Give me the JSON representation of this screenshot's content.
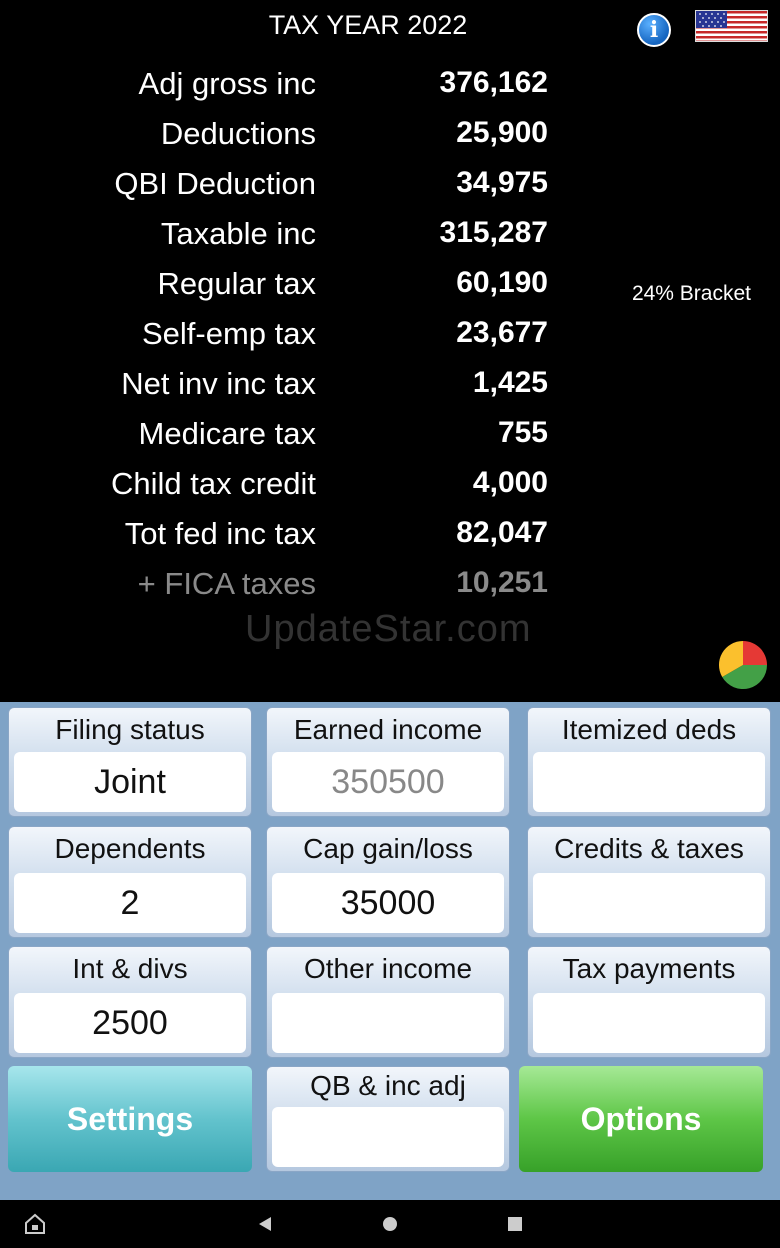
{
  "header": {
    "title": "TAX YEAR 2022",
    "info_icon": "info-icon",
    "flag_icon": "us-flag-icon"
  },
  "summary": [
    {
      "label": "Adj gross inc",
      "value": "376,162"
    },
    {
      "label": "Deductions",
      "value": "25,900"
    },
    {
      "label": "QBI Deduction",
      "value": "34,975"
    },
    {
      "label": "Taxable inc",
      "value": "315,287"
    },
    {
      "label": "Regular tax",
      "value": "60,190"
    },
    {
      "label": "Self-emp tax",
      "value": "23,677"
    },
    {
      "label": "Net inv inc tax",
      "value": "1,425"
    },
    {
      "label": "Medicare tax",
      "value": "755"
    },
    {
      "label": "Child tax credit",
      "value": "4,000"
    },
    {
      "label": "Tot fed inc tax",
      "value": "82,047"
    },
    {
      "label": "+  FICA taxes",
      "value": "10,251"
    }
  ],
  "bracket": "24% Bracket",
  "watermark": "UpdateStar.com",
  "pie_colors": [
    "#e53935",
    "#43a047",
    "#fbc02d"
  ],
  "fields": {
    "filing_status": {
      "label": "Filing status",
      "value": "Joint"
    },
    "earned_income": {
      "label": "Earned income",
      "value": "350500"
    },
    "itemized_deds": {
      "label": "Itemized deds",
      "value": ""
    },
    "dependents": {
      "label": "Dependents",
      "value": "2"
    },
    "cap_gain_loss": {
      "label": "Cap gain/loss",
      "value": "35000"
    },
    "credits_taxes": {
      "label": "Credits & taxes",
      "value": ""
    },
    "int_divs": {
      "label": "Int & divs",
      "value": "2500"
    },
    "other_income": {
      "label": "Other income",
      "value": ""
    },
    "tax_payments": {
      "label": "Tax payments",
      "value": ""
    },
    "qb_inc_adj": {
      "label": "QB & inc adj",
      "value": ""
    }
  },
  "buttons": {
    "settings": "Settings",
    "options": "Options"
  },
  "navbar": {
    "home_icon": "home-lock-icon",
    "back_icon": "back-triangle-icon",
    "home_circle_icon": "home-circle-icon",
    "recents_icon": "recents-square-icon"
  }
}
